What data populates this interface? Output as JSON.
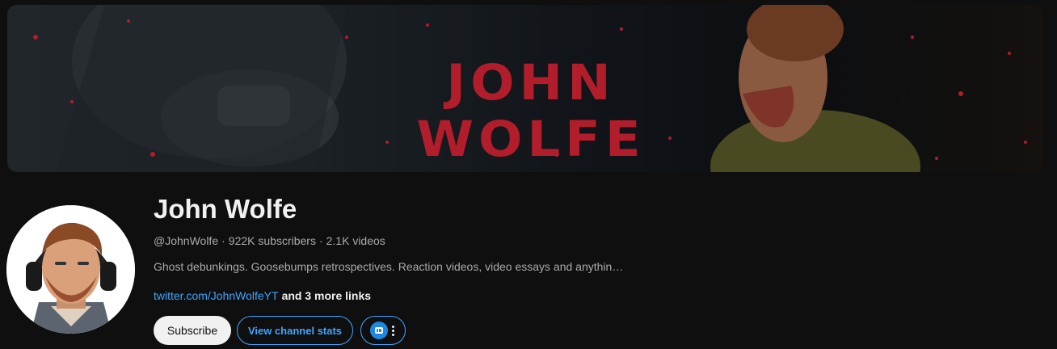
{
  "banner": {
    "title": "John Wolfe",
    "accent_color": "#b11d2a"
  },
  "channel": {
    "name": "John Wolfe",
    "handle": "@JohnWolfe",
    "separator": "·",
    "subscribers": "922K subscribers",
    "videos": "2.1K videos",
    "description": "Ghost debunkings. Goosebumps retrospectives. Reaction videos, video essays and anythin…",
    "link_text": "twitter.com/JohnWolfeYT",
    "more_links": "and 3 more links"
  },
  "actions": {
    "subscribe_label": "Subscribe",
    "stats_label": "View channel stats",
    "extension_icon": "extension-logo-icon",
    "more_icon": "more-vert-icon"
  },
  "colors": {
    "background": "#0f0f0f",
    "link": "#3ea6ff",
    "muted_text": "#aaaaaa"
  }
}
